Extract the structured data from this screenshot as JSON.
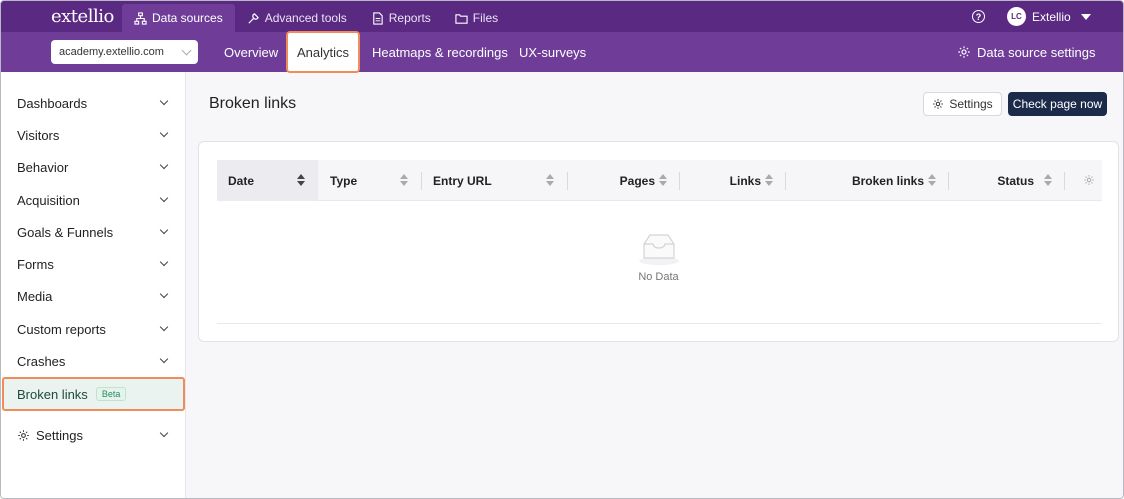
{
  "app": {
    "logo": "extellio"
  },
  "topnav": {
    "items": [
      {
        "label": "Data sources",
        "icon": "sitemap-icon"
      },
      {
        "label": "Advanced tools",
        "icon": "wrench-icon"
      },
      {
        "label": "Reports",
        "icon": "document-icon"
      },
      {
        "label": "Files",
        "icon": "folder-icon"
      }
    ],
    "help": "?",
    "user": {
      "initials": "LC",
      "name": "Extellio"
    }
  },
  "subnav": {
    "site": "academy.extellio.com",
    "items": [
      {
        "label": "Overview"
      },
      {
        "label": "Analytics"
      },
      {
        "label": "Heatmaps & recordings"
      },
      {
        "label": "UX-surveys"
      }
    ],
    "settings_label": "Data source settings"
  },
  "sidebar": {
    "items": [
      {
        "label": "Dashboards"
      },
      {
        "label": "Visitors"
      },
      {
        "label": "Behavior"
      },
      {
        "label": "Acquisition"
      },
      {
        "label": "Goals & Funnels"
      },
      {
        "label": "Forms"
      },
      {
        "label": "Media"
      },
      {
        "label": "Custom reports"
      },
      {
        "label": "Crashes"
      }
    ],
    "active": {
      "label": "Broken links",
      "badge": "Beta"
    },
    "settings": {
      "label": "Settings"
    }
  },
  "main": {
    "title": "Broken links",
    "settings_button": "Settings",
    "check_button": "Check page now",
    "table": {
      "columns": [
        {
          "label": "Date"
        },
        {
          "label": "Type"
        },
        {
          "label": "Entry URL"
        },
        {
          "label": "Pages"
        },
        {
          "label": "Links"
        },
        {
          "label": "Broken links"
        },
        {
          "label": "Status"
        }
      ],
      "empty_text": "No Data"
    }
  },
  "colors": {
    "topbar": "#5a2a82",
    "subbar": "#6f3d98",
    "highlight": "#f08b5a",
    "primary_button": "#1d2b4a",
    "beta_green": "#2a8a63"
  }
}
